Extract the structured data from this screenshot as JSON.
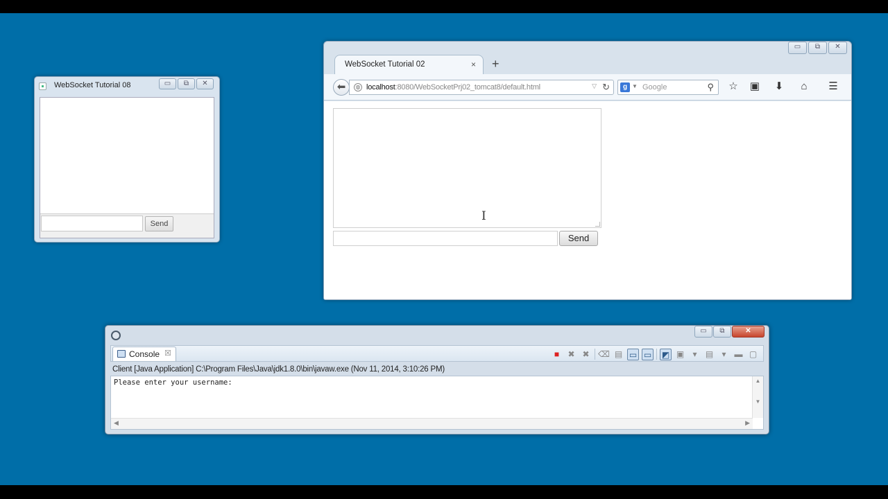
{
  "swing_window": {
    "title": "WebSocket Tutorial 08",
    "send_label": "Send"
  },
  "browser": {
    "tab_title": "WebSocket Tutorial 02",
    "tab_close": "×",
    "new_tab": "+",
    "url_host": "localhost",
    "url_rest": ":8080/WebSocketPrj02_tomcat8/default.html",
    "search_placeholder": "Google",
    "search_engine_logo": "g",
    "send_label": "Send"
  },
  "console_window": {
    "tab_label": "Console",
    "tab_close": "☒",
    "description": "Client [Java Application] C:\\Program Files\\Java\\jdk1.8.0\\bin\\javaw.exe (Nov 11, 2014, 3:10:26 PM)",
    "output": "Please enter your username:"
  },
  "window_buttons": {
    "minimize": "▭",
    "maximize": "⧉",
    "close": "✕"
  },
  "icons": {
    "back": "back-arrow-icon",
    "reload": "reload-icon",
    "search": "magnifier-icon",
    "bookmark": "star-icon",
    "library": "clipboard-icon",
    "downloads": "download-arrow-icon",
    "home": "home-icon",
    "menu": "hamburger-menu-icon",
    "terminate": "stop-square-icon"
  },
  "colors": {
    "desktop": "#006ea8",
    "terminate": "#dd2222",
    "close_button": "#c7442c"
  }
}
